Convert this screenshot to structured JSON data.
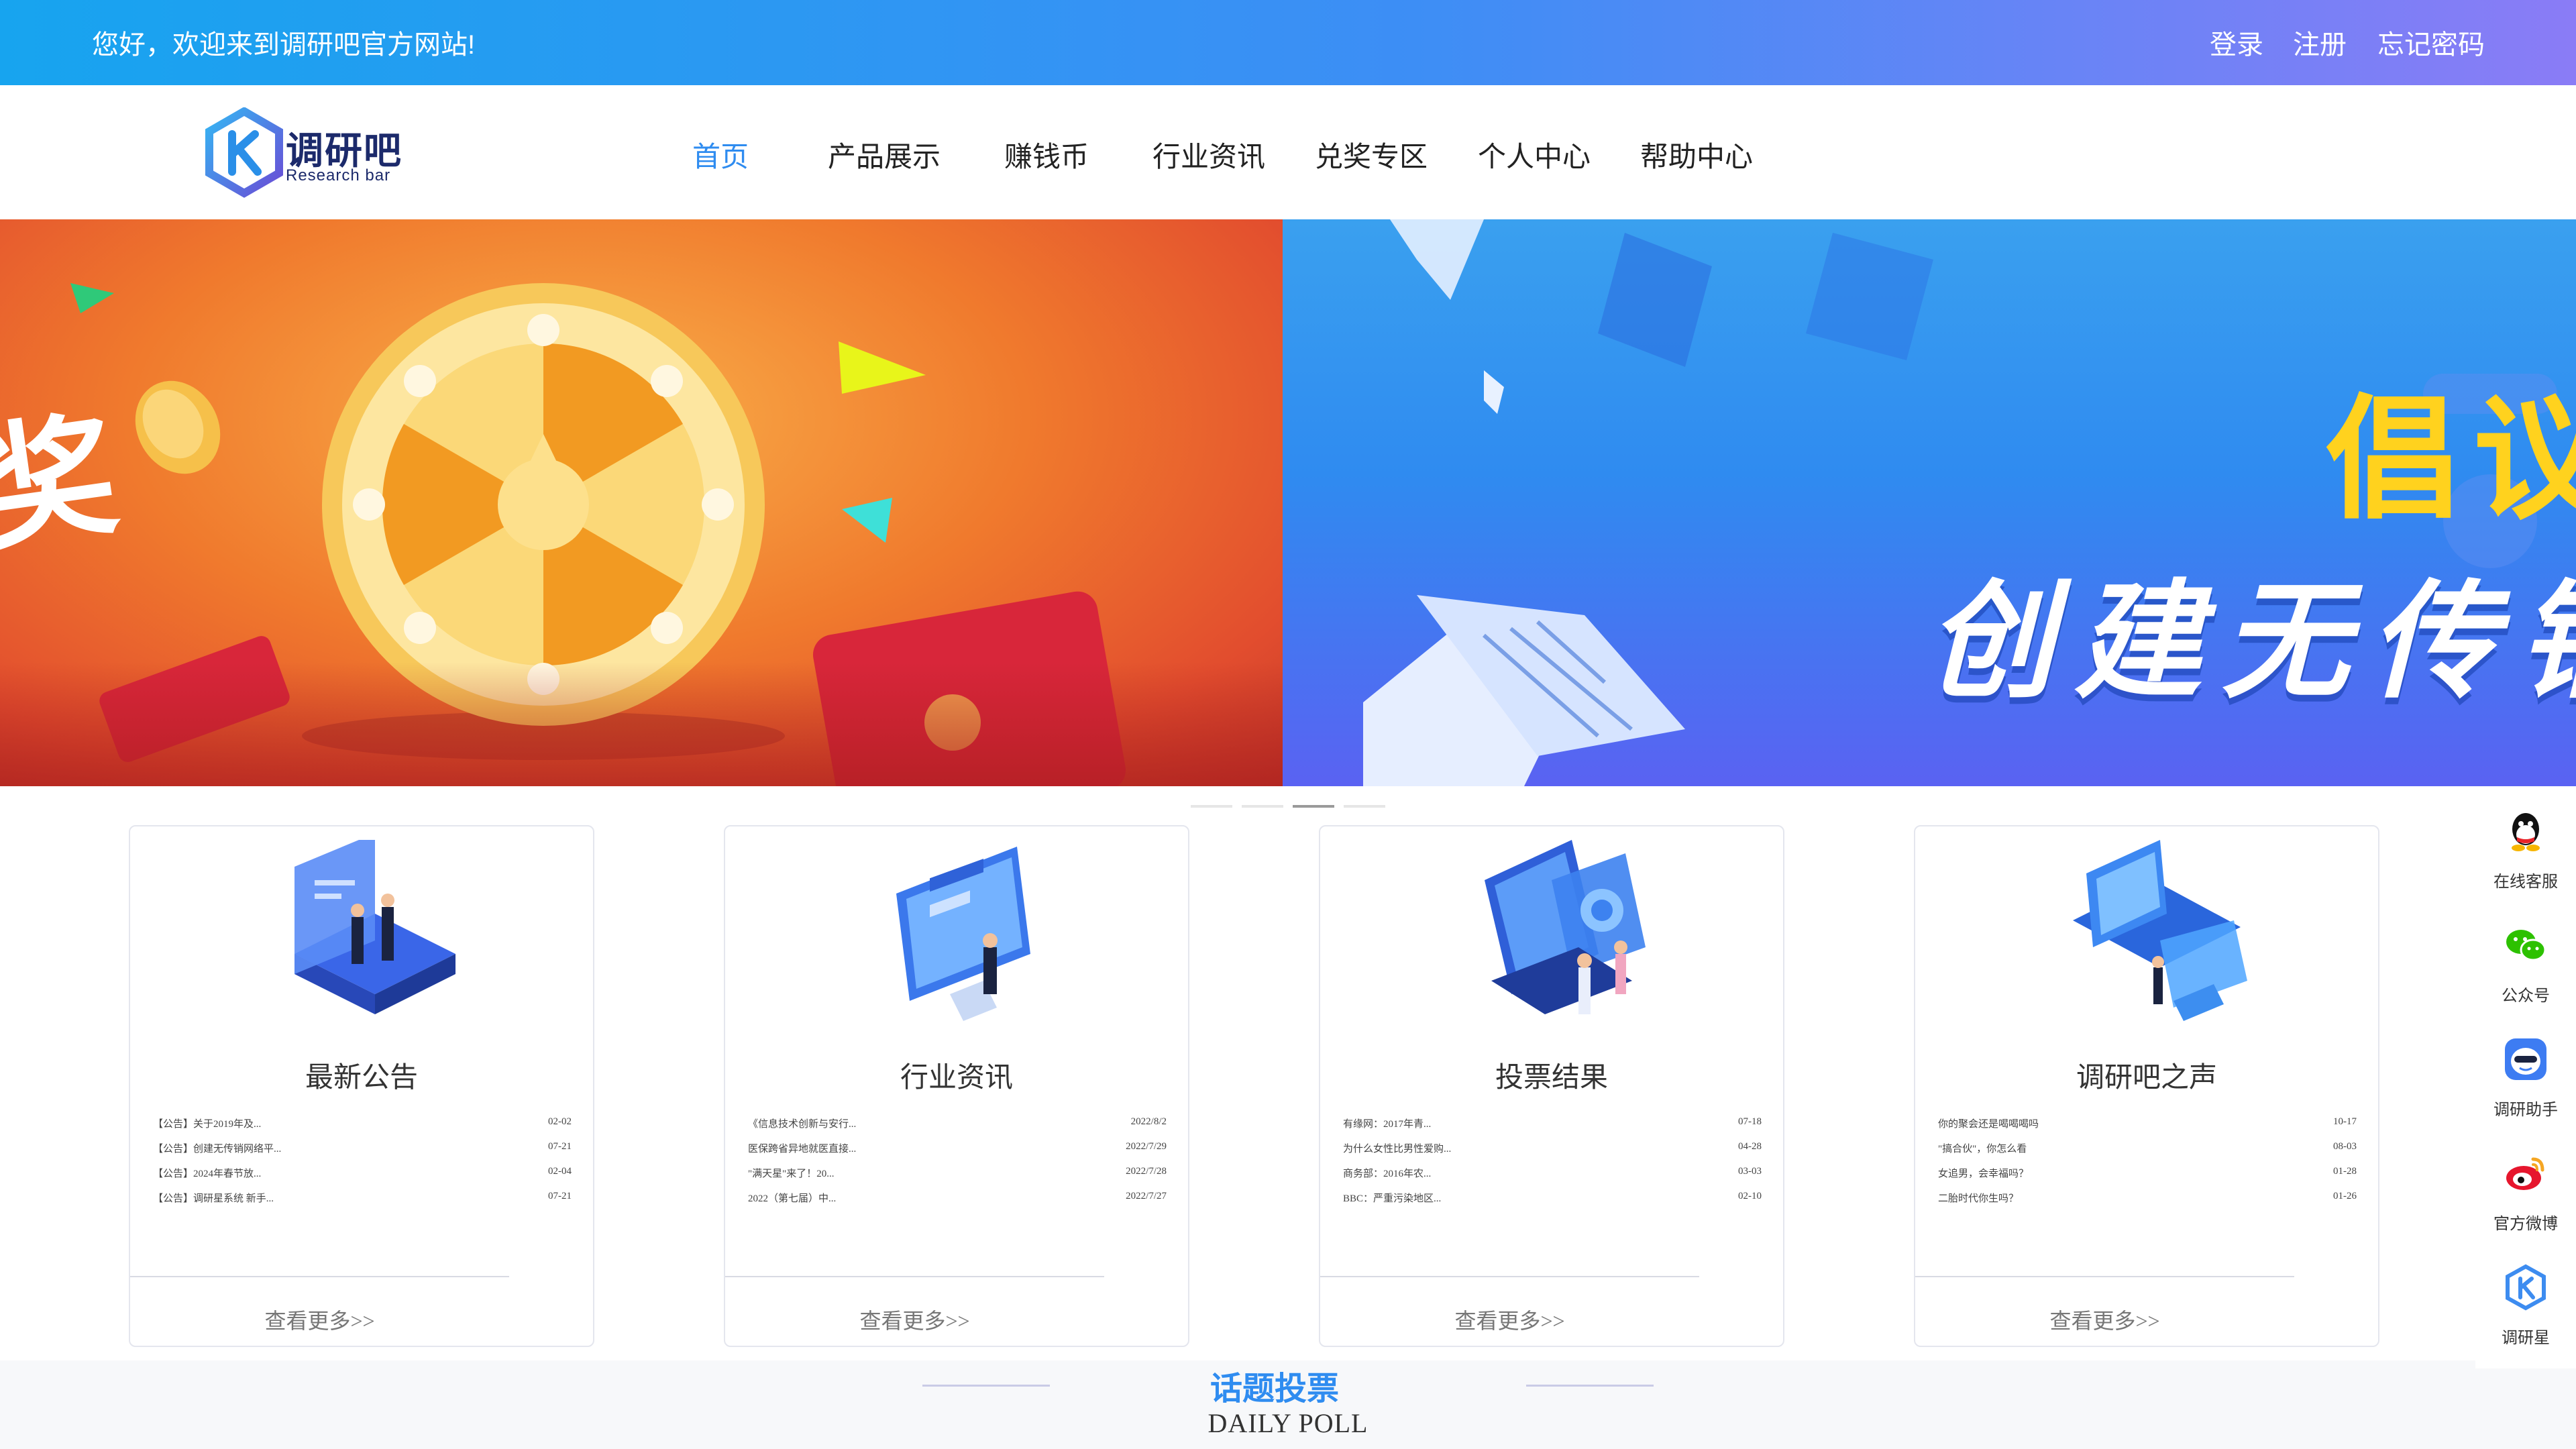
{
  "topbar": {
    "welcome": "您好，欢迎来到调研吧官方网站!",
    "login": "登录",
    "register": "注册",
    "forgot": "忘记密码"
  },
  "logo": {
    "name": "调研吧",
    "subtitle": "Research bar"
  },
  "nav": {
    "items": [
      {
        "label": "首页",
        "active": true
      },
      {
        "label": "产品展示"
      },
      {
        "label": "赚钱币"
      },
      {
        "label": "行业资讯"
      },
      {
        "label": "兑奖专区"
      },
      {
        "label": "个人中心"
      },
      {
        "label": "帮助中心"
      }
    ]
  },
  "banner": {
    "left_text": "奖",
    "right_title": "倡议",
    "right_subtitle": "创建无传销",
    "indicator_count": 4,
    "active_indicator": 2
  },
  "cards": [
    {
      "title": "最新公告",
      "icon": "meeting-illustration",
      "rows": [
        {
          "text": "【公告】关于2019年及...",
          "date": "02-02"
        },
        {
          "text": "【公告】创建无传销网络平...",
          "date": "07-21"
        },
        {
          "text": "【公告】2024年春节放...",
          "date": "02-04"
        },
        {
          "text": "【公告】调研星系统 新手...",
          "date": "07-21"
        }
      ],
      "more": "查看更多>>"
    },
    {
      "title": "行业资讯",
      "icon": "monitor-illustration",
      "rows": [
        {
          "text": "《信息技术创新与安行...",
          "date": "2022/8/2"
        },
        {
          "text": "医保跨省异地就医直接...",
          "date": "2022/7/29"
        },
        {
          "text": "\"满天星\"来了！20...",
          "date": "2022/7/28"
        },
        {
          "text": "2022（第七届）中...",
          "date": "2022/7/27"
        }
      ],
      "more": "查看更多>>"
    },
    {
      "title": "投票结果",
      "icon": "dashboard-illustration",
      "rows": [
        {
          "text": "有缘网：2017年青...",
          "date": "07-18"
        },
        {
          "text": "为什么女性比男性爱购...",
          "date": "04-28"
        },
        {
          "text": "商务部：2016年农...",
          "date": "03-03"
        },
        {
          "text": "BBC：严重污染地区...",
          "date": "02-10"
        }
      ],
      "more": "查看更多>>"
    },
    {
      "title": "调研吧之声",
      "icon": "laptop-illustration",
      "rows": [
        {
          "text": "你的聚会还是喝喝喝吗",
          "date": "10-17"
        },
        {
          "text": "\"搞合伙\"，你怎么看",
          "date": "08-03"
        },
        {
          "text": "女追男，会幸福吗？",
          "date": "01-28"
        },
        {
          "text": "二胎时代你生吗？",
          "date": "01-26"
        }
      ],
      "more": "查看更多>>"
    }
  ],
  "poll": {
    "title": "话题投票",
    "subtitle": "DAILY POLL"
  },
  "side_tools": [
    {
      "label": "在线客服",
      "icon": "qq-icon"
    },
    {
      "label": "公众号",
      "icon": "wechat-icon"
    },
    {
      "label": "调研助手",
      "icon": "assistant-icon"
    },
    {
      "label": "官方微博",
      "icon": "weibo-icon"
    },
    {
      "label": "调研星",
      "icon": "research-star-icon"
    }
  ],
  "colors": {
    "topbar_start": "#17a4ef",
    "topbar_end": "#8a7cf6",
    "accent": "#2f8cf0",
    "logo_dark": "#1c2a6b"
  }
}
